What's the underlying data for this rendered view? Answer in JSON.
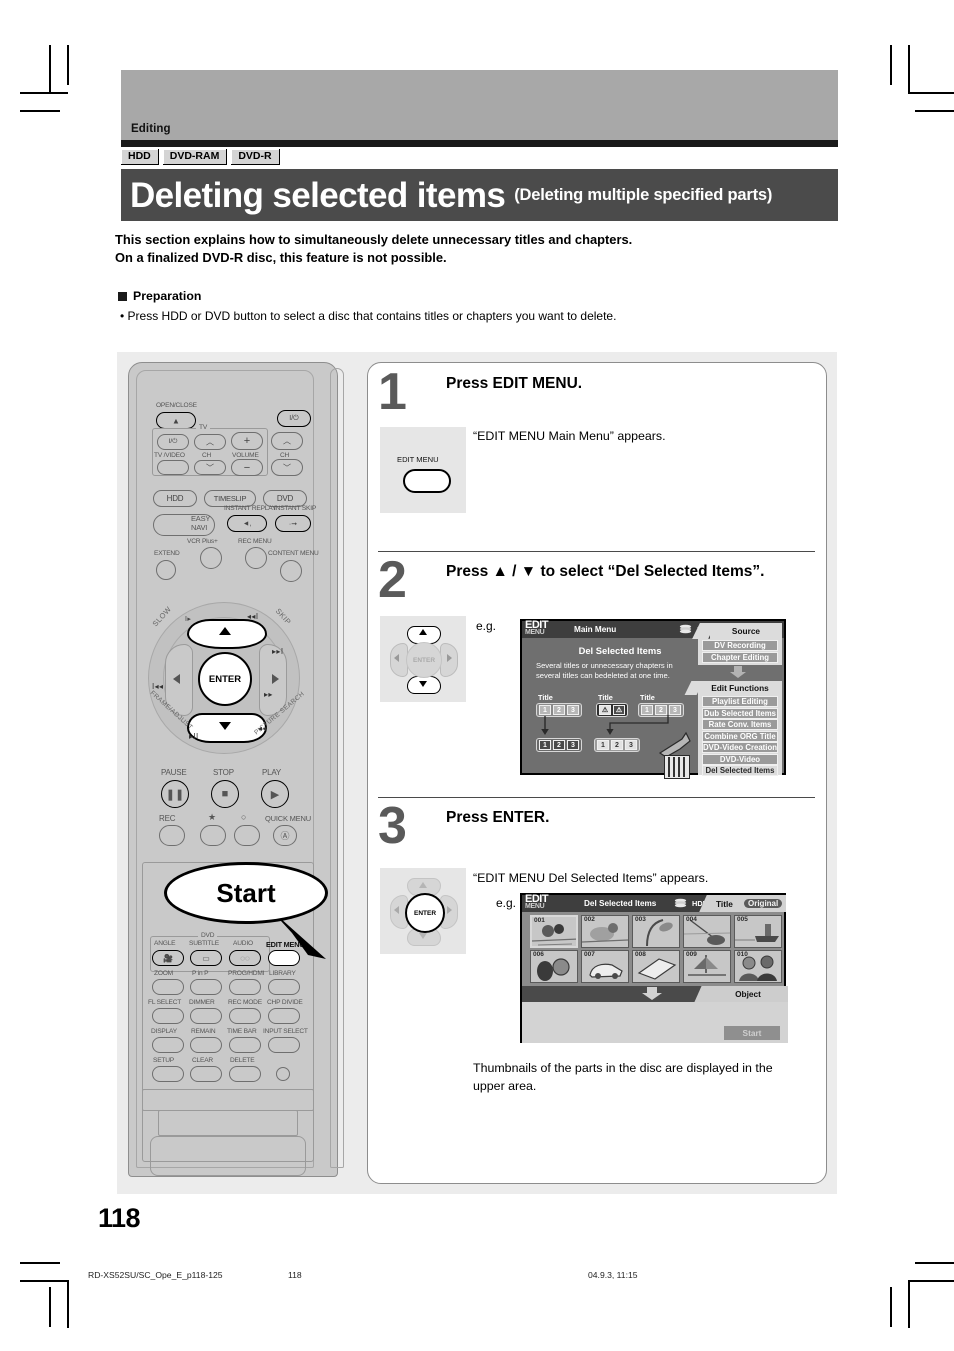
{
  "page": {
    "number": "118",
    "chapter": "Editing",
    "media_badges": [
      "HDD",
      "DVD-RAM",
      "DVD-R"
    ],
    "title": "Deleting selected items",
    "subtitle": "(Deleting multiple specified parts)",
    "intro_line1": "This section explains how to simultaneously delete unnecessary titles and chapters.",
    "intro_line2": "On a finalized DVD-R disc, this feature is not possible.",
    "preparation_heading": "Preparation",
    "preparation_bullet": "• Press HDD or DVD button to select a disc that contains titles or chapters you want to delete.",
    "footer_file": "RD-XS52SU/SC_Ope_E_p118-125",
    "footer_page": "118",
    "footer_stamp": "04.9.3, 11:15"
  },
  "remote": {
    "labels": {
      "open_close": "OPEN/CLOSE",
      "tv": "TV",
      "tv_video": "TV /VIDEO",
      "ch_left": "CH",
      "volume": "VOLUME",
      "ch_right": "CH",
      "hdd": "HDD",
      "timeslip": "TIMESLIP",
      "dvd": "DVD",
      "easy_navi": "EASY\nNAVI",
      "instant_replay": "INSTANT REPLAY",
      "instant_skip": "INSTANT SKIP",
      "vcr_plus": "VCR Plus+",
      "rec_menu": "REC MENU",
      "extend": "EXTEND",
      "content_menu": "CONTENT MENU",
      "slow": "SLOW",
      "skip": "SKIP",
      "frame_adjust": "FRAME/ADJUST",
      "picture_search": "PICTURE SEARCH",
      "enter": "ENTER",
      "pause": "PAUSE",
      "stop": "STOP",
      "play": "PLAY",
      "rec": "REC",
      "quick_menu": "QUICK MENU",
      "dvd_group": "DVD",
      "angle": "ANGLE",
      "subtitle": "SUBTITLE",
      "audio": "AUDIO",
      "edit_menu": "EDIT MENU",
      "zoom": "ZOOM",
      "p_in_p": "P in P",
      "prog_hdmi": "PROG/HDMI",
      "library": "LIBRARY",
      "fl_select": "FL SELECT",
      "dimmer": "DIMMER",
      "rec_mode": "REC MODE",
      "chp_divide": "CHP DIVIDE",
      "display": "DISPLAY",
      "remain": "REMAIN",
      "time_bar": "TIME BAR",
      "input_select": "INPUT SELECT",
      "setup": "SETUP",
      "clear": "CLEAR",
      "delete": "DELETE",
      "power": "I/⏻"
    },
    "callout": "Start"
  },
  "steps": [
    {
      "num": "1",
      "title": "Press EDIT MENU.",
      "note": "“EDIT MENU Main Menu” appears.",
      "key_label": "EDIT MENU"
    },
    {
      "num": "2",
      "title": "Press ▲ / ▼ to select “Del Selected Items”.",
      "eg": "e.g.",
      "key_label": "ENTER"
    },
    {
      "num": "3",
      "title": "Press ENTER.",
      "note": "“EDIT MENU Del Selected Items” appears.",
      "eg": "e.g.",
      "key_label": "ENTER",
      "caption_line1": "Thumbnails of the parts in the disc are displayed in the",
      "caption_line2": "upper area."
    }
  ],
  "osd_main": {
    "logo": "EDIT",
    "logo_sub": "MENU",
    "title": "Main Menu",
    "source_label": "HDD",
    "heading": "Del Selected Items",
    "body": "Several titles or unnecessary chapters in several titles can bedeleted at one time.",
    "title_labels": [
      "Title",
      "Title",
      "Title"
    ],
    "chips_a": [
      "1",
      "2",
      "3"
    ],
    "chips_b": [
      "⚠",
      "⚠"
    ],
    "chips_c": [
      "1",
      "2",
      "3"
    ],
    "chips_d": [
      "1",
      "2",
      "3"
    ],
    "chips_e": [
      "1",
      "2",
      "3"
    ],
    "source_tab": "Source",
    "source_items": [
      "DV Recording",
      "Chapter Editing"
    ],
    "functions_tab": "Edit Functions",
    "function_items": [
      "Playlist Editing",
      "Dub Selected Items",
      "Rate Conv. Items",
      "Combine ORG Title",
      "DVD-Video Creation",
      "DVD-Video Finalizing",
      "Del Selected Items"
    ],
    "selected_function": "Del Selected Items"
  },
  "osd_del": {
    "logo": "EDIT",
    "logo_sub": "MENU",
    "title": "Del Selected Items",
    "source_label": "HDD",
    "mode_label": "Title",
    "mode_value": "Original",
    "thumbnails": [
      "001",
      "002",
      "003",
      "004",
      "005",
      "006",
      "007",
      "008",
      "009",
      "010"
    ],
    "object_tab": "Object",
    "start_button": "Start"
  },
  "colors": {
    "title_band": "#4b4b4b",
    "chapter_band": "#a8a8a8",
    "panel_bg": "#ececec",
    "osd_bg": "#6f6f6f",
    "accent_dark": "#1a1a1a"
  }
}
